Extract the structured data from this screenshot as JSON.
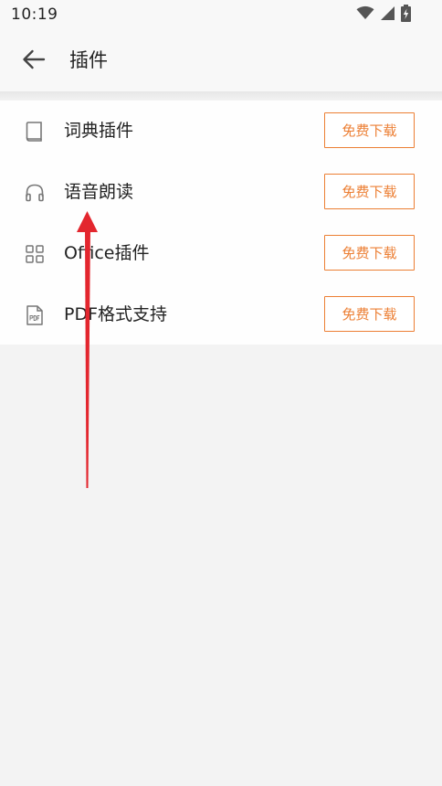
{
  "status_bar": {
    "time": "10:19",
    "icons": [
      "wifi-icon",
      "signal-icon",
      "battery-charging-icon"
    ]
  },
  "app_bar": {
    "back_icon": "arrow-left-icon",
    "title": "插件"
  },
  "plugins": [
    {
      "label": "词典插件",
      "icon": "book-icon",
      "button_label": "免费下载"
    },
    {
      "label": "语音朗读",
      "icon": "headphones-icon",
      "button_label": "免费下载"
    },
    {
      "label": "Office插件",
      "icon": "office-icon",
      "button_label": "免费下载"
    },
    {
      "label": "PDF格式支持",
      "icon": "pdf-file-icon",
      "button_label": "免费下载"
    }
  ],
  "colors": {
    "accent": "#ec7f34",
    "annotation": "#e3262e",
    "page_background": "#f3f3f3",
    "list_background": "#fefefe"
  },
  "annotation": {
    "type": "arrow",
    "direction": "up",
    "points_to": "语音朗读"
  }
}
